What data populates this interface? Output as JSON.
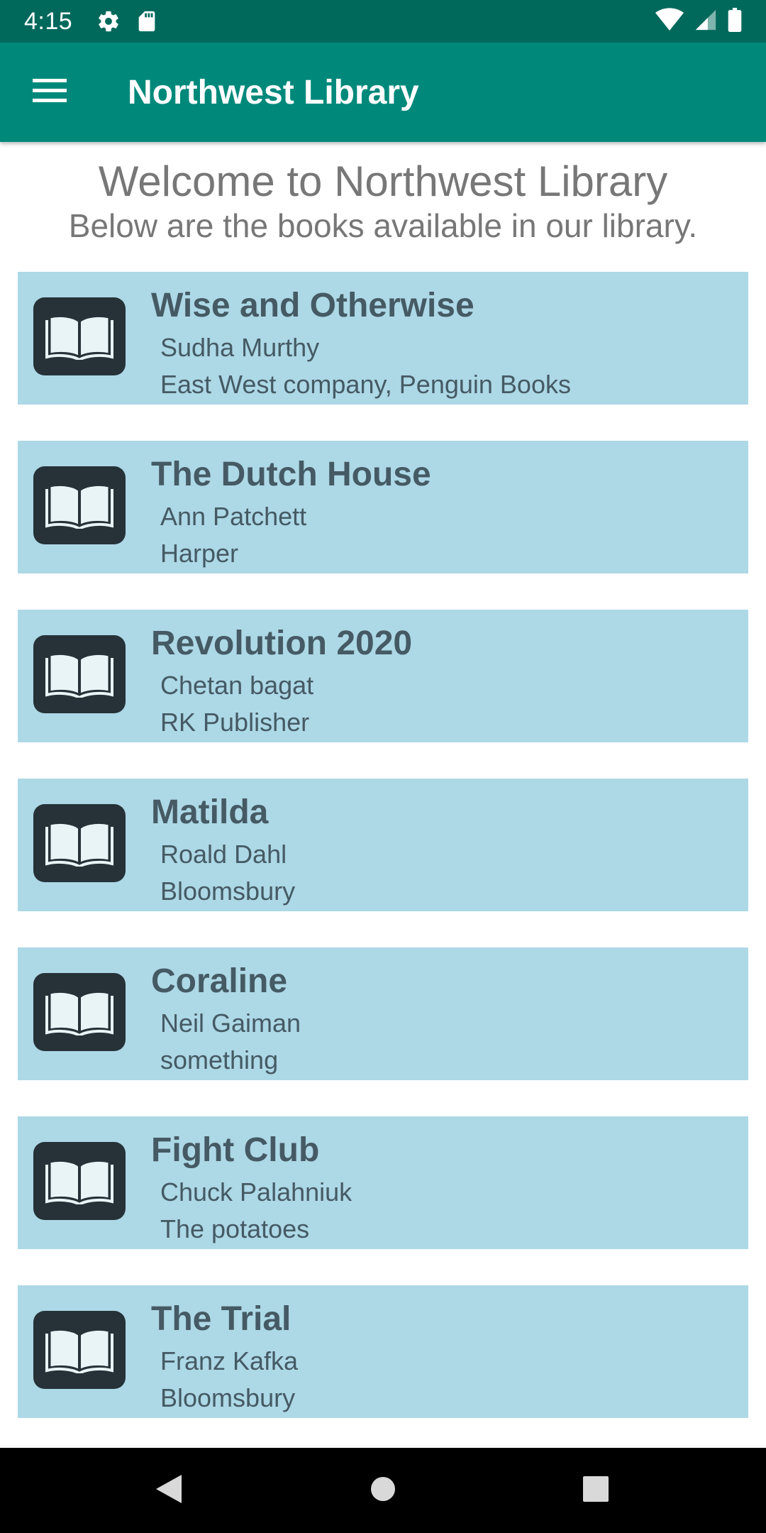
{
  "status_bar": {
    "time": "4:15",
    "icons": [
      "gear-icon",
      "sd-card-icon",
      "wifi-icon",
      "signal-icon",
      "battery-icon"
    ]
  },
  "app_bar": {
    "title": "Northwest Library",
    "menu_icon": "hamburger-menu-icon"
  },
  "header": {
    "welcome": "Welcome to Northwest Library",
    "subtitle": "Below are the books available in our library."
  },
  "books": [
    {
      "title": "Wise and Otherwise",
      "author": "Sudha Murthy",
      "publisher": "East West company, Penguin Books"
    },
    {
      "title": "The Dutch House",
      "author": "Ann Patchett",
      "publisher": "Harper"
    },
    {
      "title": "Revolution 2020",
      "author": "Chetan bagat",
      "publisher": "RK Publisher"
    },
    {
      "title": "Matilda",
      "author": "Roald Dahl",
      "publisher": "Bloomsbury"
    },
    {
      "title": "Coraline",
      "author": "Neil Gaiman",
      "publisher": "something"
    },
    {
      "title": "Fight Club",
      "author": "Chuck Palahniuk",
      "publisher": "The potatoes"
    },
    {
      "title": "The Trial",
      "author": "Franz Kafka",
      "publisher": "Bloomsbury"
    }
  ],
  "colors": {
    "status_bar": "#00695c",
    "app_bar": "#00897b",
    "card_background": "#add8e6",
    "card_text": "#455a64",
    "icon_background": "#263238"
  },
  "nav_bar": {
    "buttons": [
      "back-icon",
      "home-icon",
      "recents-icon"
    ]
  }
}
